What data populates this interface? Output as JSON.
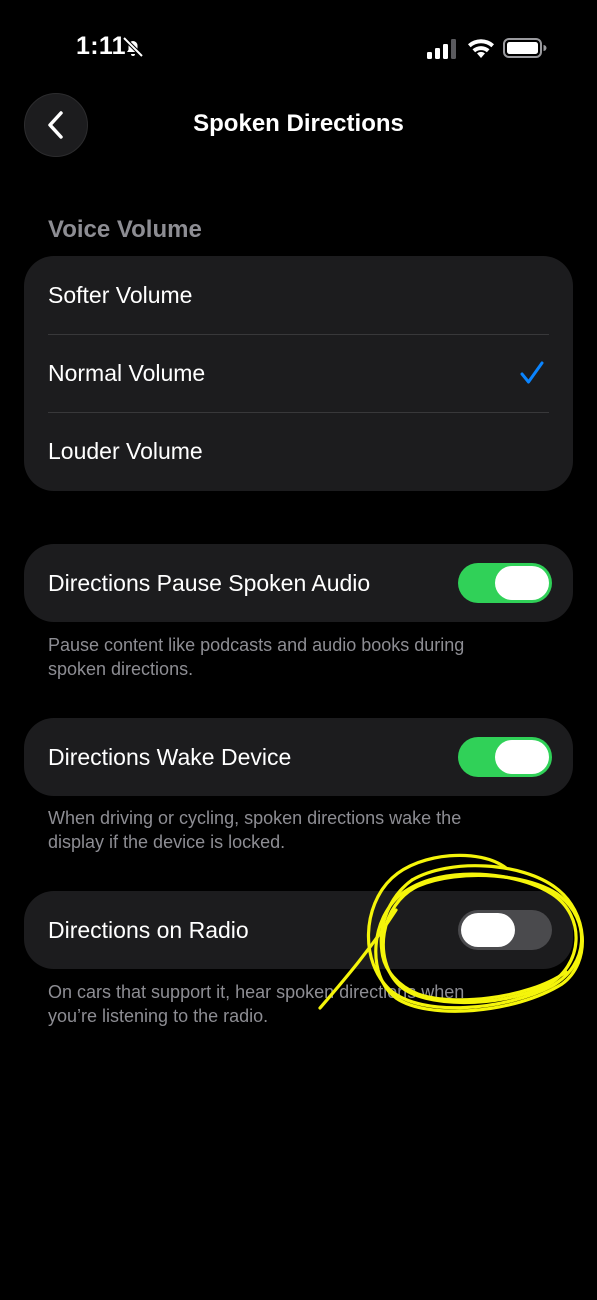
{
  "status_bar": {
    "time": "1:11",
    "icons": [
      "bell-slash-icon",
      "cellular-signal-icon",
      "wifi-icon",
      "battery-icon"
    ]
  },
  "nav": {
    "back_icon": "chevron-left-icon",
    "title": "Spoken Directions"
  },
  "voice_volume": {
    "header": "Voice Volume",
    "options": [
      {
        "label": "Softer Volume",
        "selected": false
      },
      {
        "label": "Normal Volume",
        "selected": true
      },
      {
        "label": "Louder Volume",
        "selected": false
      }
    ],
    "check_color": "#0a84ff"
  },
  "settings": [
    {
      "label": "Directions Pause Spoken Audio",
      "on": true,
      "footnote_line1": "Pause content like podcasts and audio books during",
      "footnote_line2": "spoken directions."
    },
    {
      "label": "Directions Wake Device",
      "on": true,
      "footnote_line1": "When driving or cycling, spoken directions wake the",
      "footnote_line2": "display if the device is locked."
    },
    {
      "label": "Directions on Radio",
      "on": false,
      "footnote_line1": "On cars that support it, hear spoken directions when",
      "footnote_line2": "you’re listening to the radio."
    }
  ],
  "colors": {
    "toggle_on": "#30d158",
    "toggle_off": "#4a4a4d",
    "annotation": "#f5f50a"
  }
}
